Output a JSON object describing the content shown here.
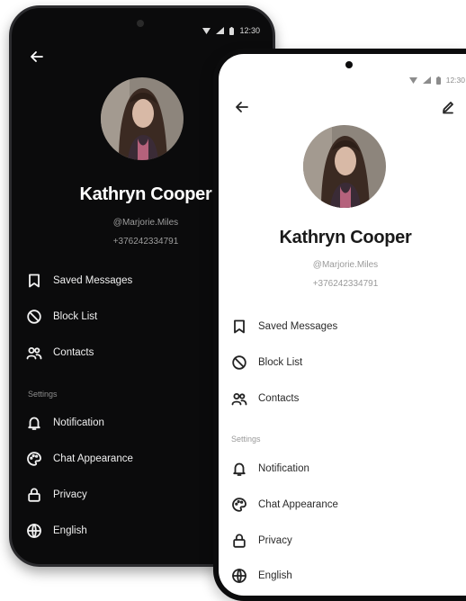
{
  "status_bar": {
    "time": "12:30"
  },
  "profile": {
    "name": "Kathryn Cooper",
    "handle": "@Marjorie.Miles",
    "phone": "+376242334791"
  },
  "menu": [
    {
      "label": "Saved Messages",
      "icon": "bookmark-icon"
    },
    {
      "label": "Block List",
      "icon": "block-icon"
    },
    {
      "label": "Contacts",
      "icon": "contacts-icon"
    }
  ],
  "settings": {
    "title": "Settings",
    "items": [
      {
        "label": "Notification",
        "icon": "bell-icon"
      },
      {
        "label": "Chat Appearance",
        "icon": "palette-icon"
      },
      {
        "label": "Privacy",
        "icon": "lock-icon"
      },
      {
        "label": "English",
        "icon": "globe-icon"
      }
    ]
  },
  "colors": {
    "dark_background": "#0b0b0c",
    "light_background": "#ffffff",
    "secondary_text": "#9a9a9a"
  }
}
